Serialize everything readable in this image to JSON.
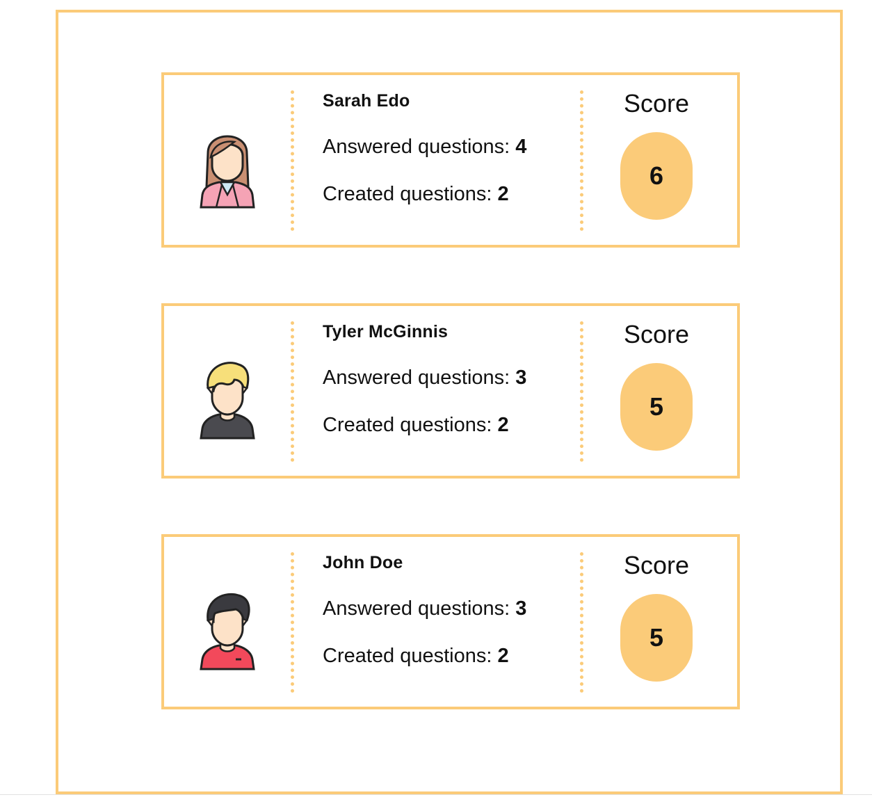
{
  "leaderboard": {
    "score_label": "Score",
    "answered_label": "Answered questions:",
    "created_label": "Created questions:",
    "users": [
      {
        "name": "Sarah Edo",
        "answered": "4",
        "created": "2",
        "score": "6",
        "avatar_icon": "woman-avatar-icon"
      },
      {
        "name": "Tyler McGinnis",
        "answered": "3",
        "created": "2",
        "score": "5",
        "avatar_icon": "blond-man-avatar-icon"
      },
      {
        "name": "John Doe",
        "answered": "3",
        "created": "2",
        "score": "5",
        "avatar_icon": "dark-hair-man-avatar-icon"
      }
    ]
  },
  "colors": {
    "accent": "#fbcb79",
    "text": "#111111"
  }
}
